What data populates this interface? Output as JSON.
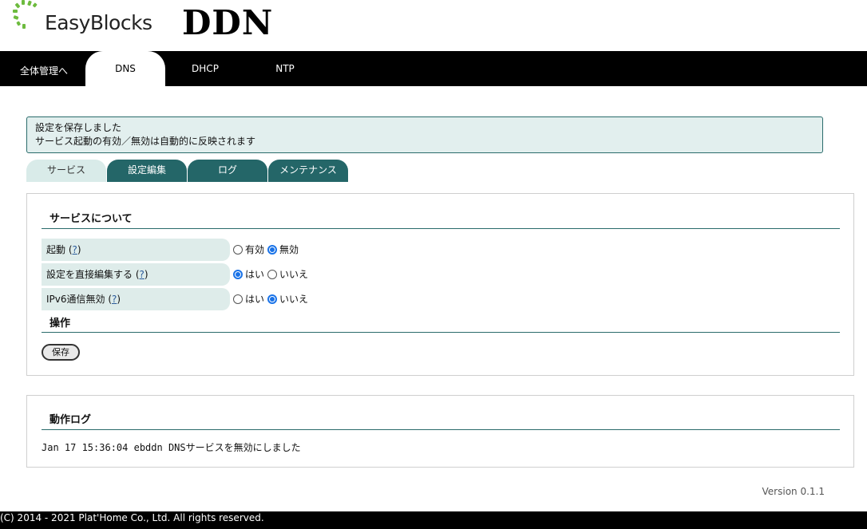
{
  "brand": {
    "logo_text": "EasyBlocks",
    "site_title": "DDN",
    "logo_accent": "#5cb85c"
  },
  "topnav": {
    "items": [
      {
        "label": "全体管理へ"
      },
      {
        "label": "DNS"
      },
      {
        "label": "DHCP"
      },
      {
        "label": "NTP"
      }
    ],
    "active_index": 1
  },
  "notice": {
    "lines": [
      "設定を保存しました",
      "サービス起動の有効／無効は自動的に反映されます"
    ]
  },
  "tabs": {
    "items": [
      {
        "label": "サービス"
      },
      {
        "label": "設定編集"
      },
      {
        "label": "ログ"
      },
      {
        "label": "メンテナンス"
      }
    ],
    "active_index": 0
  },
  "service": {
    "heading": "サービスについて",
    "rows": [
      {
        "label": "起動",
        "help": "?",
        "options": [
          "有効",
          "無効"
        ],
        "selected": 1
      },
      {
        "label": "設定を直接編集する",
        "help": "?",
        "options": [
          "はい",
          "いいえ"
        ],
        "selected": 0
      },
      {
        "label": "IPv6通信無効",
        "help": "?",
        "options": [
          "はい",
          "いいえ"
        ],
        "selected": 1
      }
    ],
    "ops_heading": "操作",
    "save_label": "保存"
  },
  "log": {
    "heading": "動作ログ",
    "line": "Jan 17 15:36:04 ebddn DNSサービスを無効にしました"
  },
  "version": "Version 0.1.1",
  "footer": {
    "copyright": "(C) 2014 - 2021 Plat'Home Co., Ltd. All rights reserved."
  },
  "colors": {
    "accent": "#246668",
    "light_accent": "#deecea",
    "radio": "#1a73e8"
  }
}
